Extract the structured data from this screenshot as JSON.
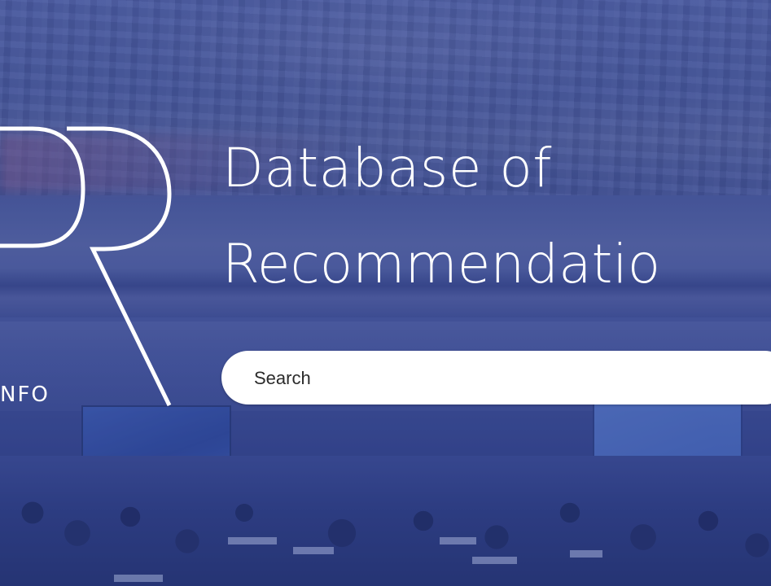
{
  "header": {
    "title_line1": "Database of",
    "title_line2": "Recommendatio"
  },
  "logo": {
    "text": "NFO",
    "icon": "upr-logo-icon"
  },
  "search": {
    "placeholder": "Search",
    "value": ""
  },
  "colors": {
    "overlay": "#2e3f86",
    "text": "#ffffff",
    "search_bg": "#ffffff"
  }
}
